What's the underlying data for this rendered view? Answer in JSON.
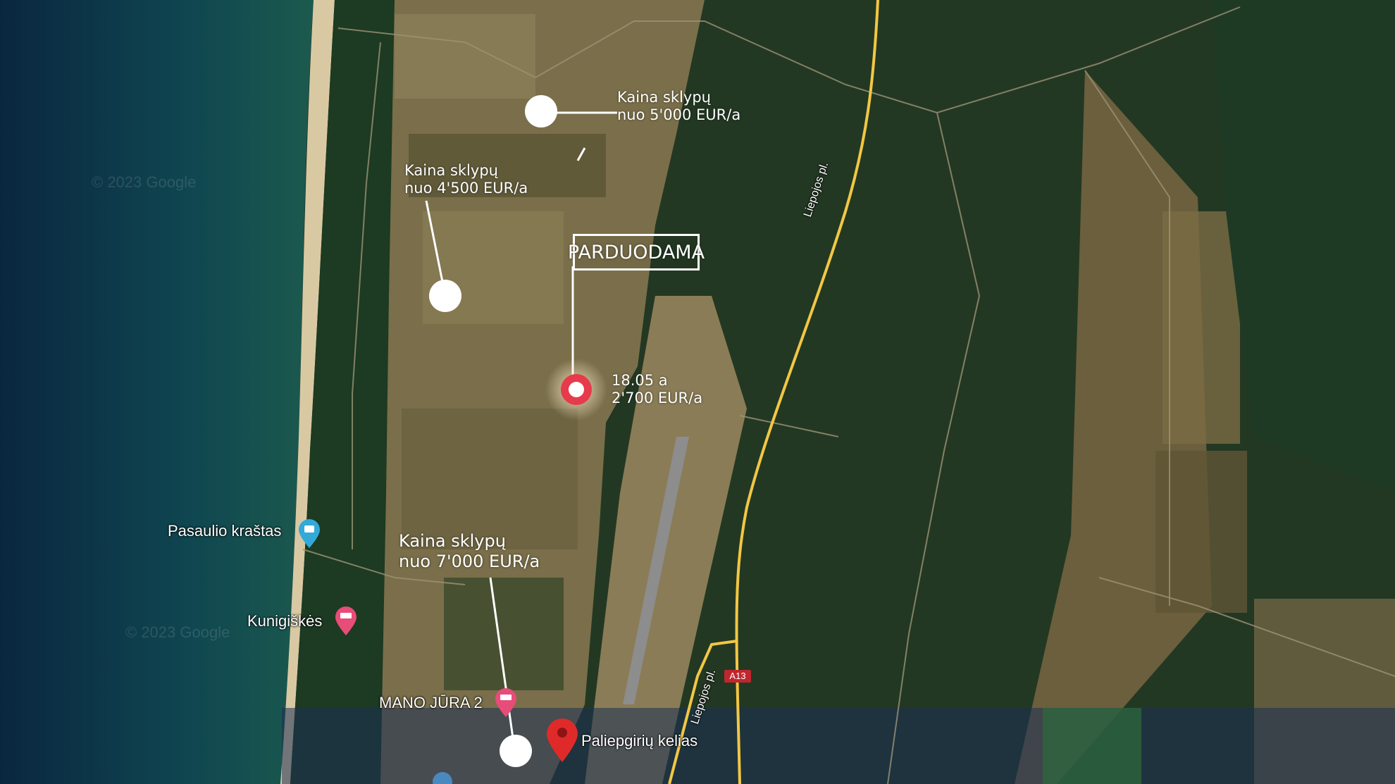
{
  "map": {
    "title": "PARDUODAMA",
    "plot": {
      "area": "18.05 a",
      "price": "2'700 EUR/a"
    },
    "callouts": [
      {
        "line1": "Kaina sklypų",
        "line2": "nuo 5'000 EUR/a"
      },
      {
        "line1": "Kaina sklypų",
        "line2": "nuo 4'500 EUR/a"
      },
      {
        "line1": "Kaina sklypų",
        "line2": "nuo 7'000 EUR/a"
      }
    ],
    "places": {
      "pasaulio": "Pasaulio kraštas",
      "kunigiskes": "Kunigiškės",
      "mano_jura": "MANO JŪRA 2",
      "paliepgiriu": "Paliepgirių kelias"
    },
    "roads": {
      "liepojos_upper": "Liepojos pl.",
      "liepojos_lower": "Liepojos pl.",
      "route_shield": "A13"
    },
    "watermark": "© 2023 Google",
    "colors": {
      "sea": "#0e3a4f",
      "beach": "#d9c9a3",
      "forest": "#1f3320",
      "field": "#7e7248",
      "road": "#f2c744",
      "marker_red": "#e53b4b",
      "pin_red": "#e02a2a",
      "poi_blue": "#33a9d9",
      "poi_pink": "#e84c78"
    }
  }
}
